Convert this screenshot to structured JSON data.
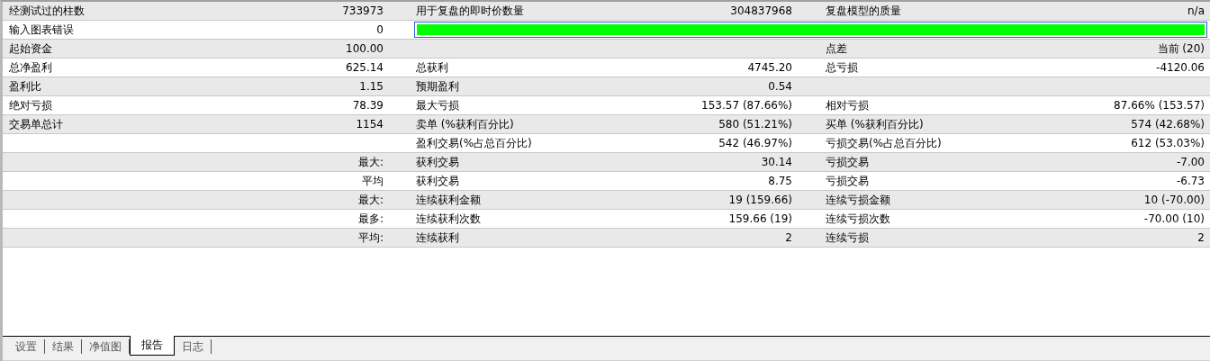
{
  "report": {
    "rows": [
      {
        "l1": "经测试过的柱数",
        "v1": "733973",
        "l2": "用于复盘的即时价数量",
        "v2": "304837968",
        "l3": "复盘模型的质量",
        "v3": "n/a"
      },
      {
        "kind": "bar",
        "l1": "输入图表错误",
        "v1": "0",
        "level": 1
      },
      {
        "l1": "起始资金",
        "v1": "100.00",
        "l3": "点差",
        "v3": "当前 (20)"
      },
      {
        "l1": "总净盈利",
        "v1": "625.14",
        "l2": "总获利",
        "v2": "4745.20",
        "l3": "总亏损",
        "v3": "-4120.06"
      },
      {
        "l1": "盈利比",
        "v1": "1.15",
        "l2": "预期盈利",
        "v2": "0.54"
      },
      {
        "l1": "绝对亏损",
        "v1": "78.39",
        "l2": "最大亏损",
        "v2": "153.57 (87.66%)",
        "l3": "相对亏损",
        "v3": "87.66% (153.57)"
      },
      {
        "l1": "交易单总计",
        "v1": "1154",
        "l2": "卖单 (%获利百分比)",
        "v2": "580 (51.21%)",
        "l3": "买单 (%获利百分比)",
        "v3": "574 (42.68%)"
      },
      {
        "l2": "盈利交易(%占总百分比)",
        "v2": "542 (46.97%)",
        "l3": "亏损交易(%占总百分比)",
        "v3": "612 (53.03%)"
      },
      {
        "v1": "最大:",
        "l2": "获利交易",
        "v2": "30.14",
        "l3": "亏损交易",
        "v3": "-7.00"
      },
      {
        "v1": "平均",
        "l2": "获利交易",
        "v2": "8.75",
        "l3": "亏损交易",
        "v3": "-6.73"
      },
      {
        "v1": "最大:",
        "l2": "连续获利金额",
        "v2": "19 (159.66)",
        "l3": "连续亏损金额",
        "v3": "10 (-70.00)"
      },
      {
        "v1": "最多:",
        "l2": "连续获利次数",
        "v2": "159.66 (19)",
        "l3": "连续亏损次数",
        "v3": "-70.00 (10)"
      },
      {
        "v1": "平均:",
        "l2": "连续获利",
        "v2": "2",
        "l3": "连续亏损",
        "v3": "2"
      }
    ]
  },
  "tabs": [
    {
      "label": "设置",
      "selected": false
    },
    {
      "label": "结果",
      "selected": false
    },
    {
      "label": "净值图",
      "selected": false
    },
    {
      "label": "报告",
      "selected": true
    },
    {
      "label": "日志",
      "selected": false
    }
  ]
}
